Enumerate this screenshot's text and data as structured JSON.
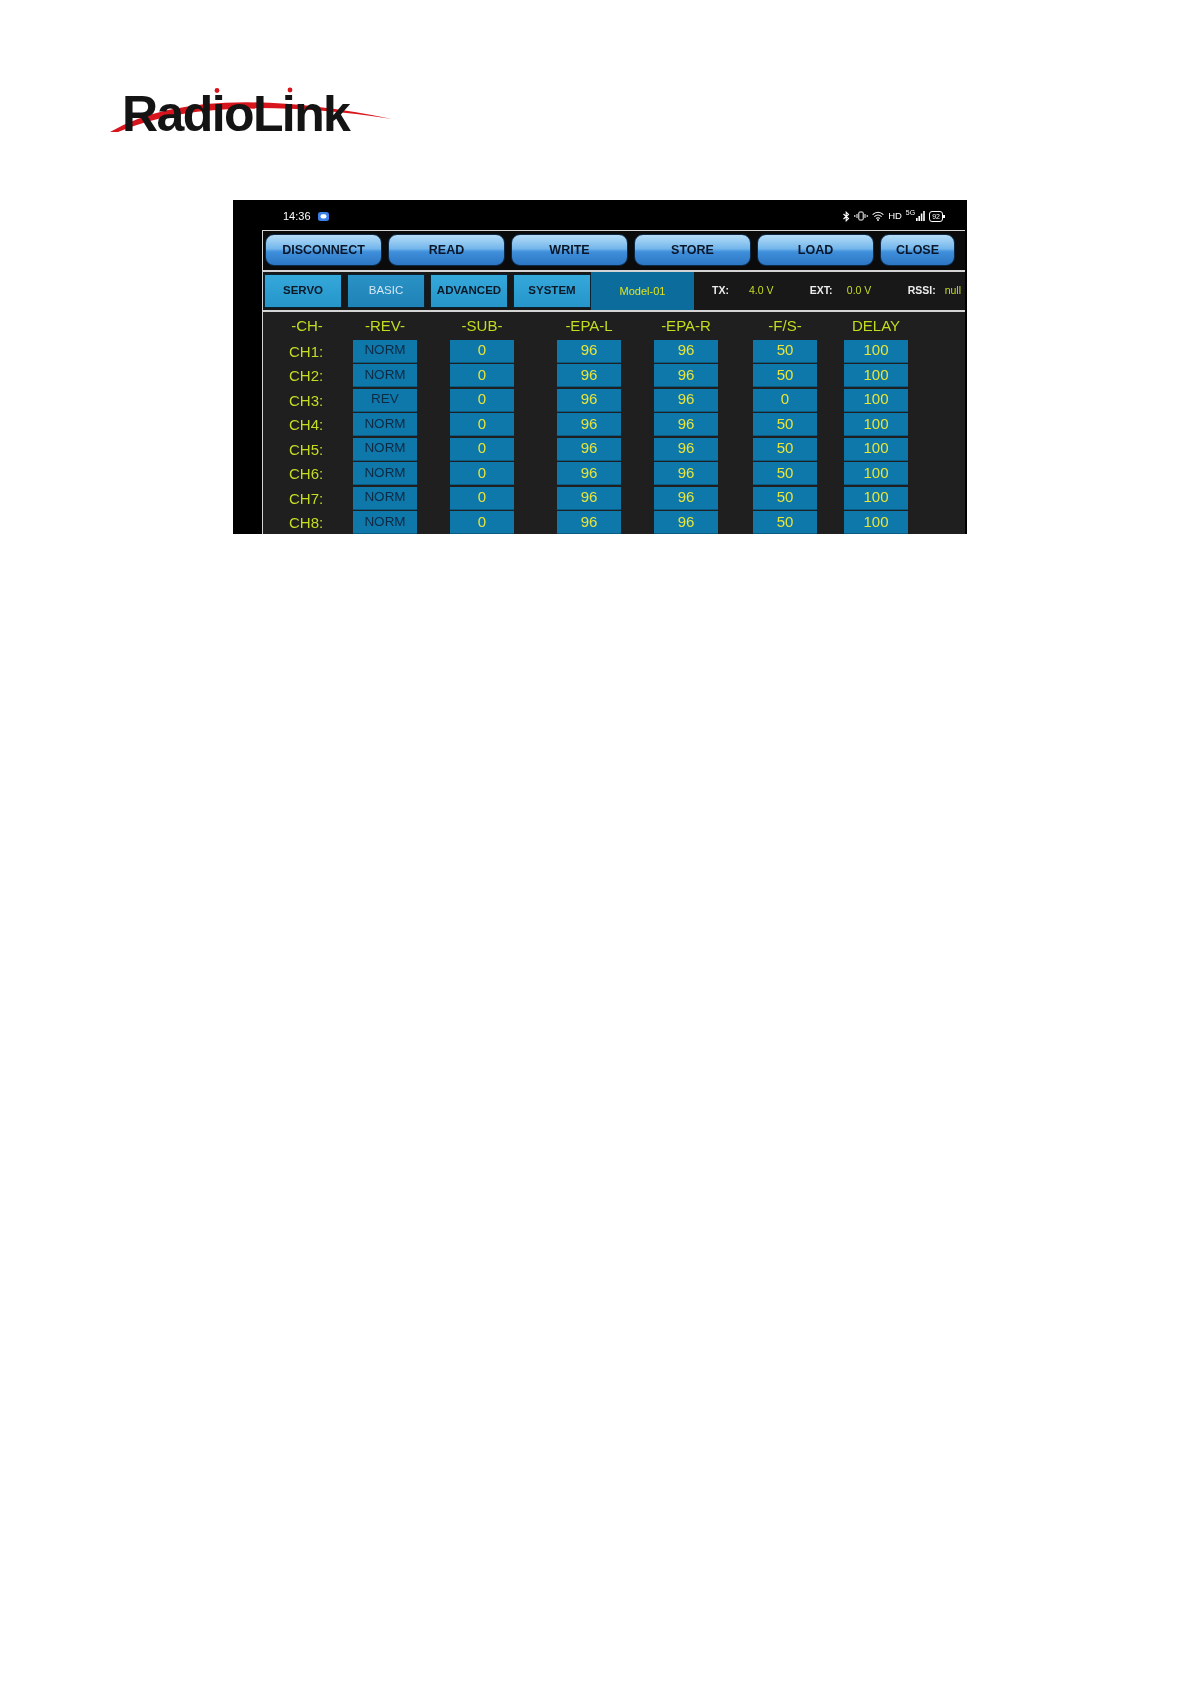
{
  "logo": {
    "text": "RadioLink"
  },
  "status_bar": {
    "time": "14:36",
    "hd": "HD",
    "network": "5G",
    "battery": "92"
  },
  "toolbar": {
    "buttons": [
      "DISCONNECT",
      "READ",
      "WRITE",
      "STORE",
      "LOAD",
      "CLOSE"
    ]
  },
  "tabs": [
    {
      "label": "SERVO",
      "disabled": false
    },
    {
      "label": "BASIC",
      "disabled": true
    },
    {
      "label": "ADVANCED",
      "disabled": false
    },
    {
      "label": "SYSTEM",
      "disabled": false
    }
  ],
  "model": "Model-01",
  "readings": [
    {
      "label": "TX:",
      "value": "4.0 V"
    },
    {
      "label": "EXT:",
      "value": "0.0 V"
    },
    {
      "label": "RSSI:",
      "value": "null"
    }
  ],
  "table": {
    "columns": [
      "-CH-",
      "-REV-",
      "-SUB-",
      "-EPA-L",
      "-EPA-R",
      "-F/S-",
      "DELAY"
    ],
    "rows": [
      [
        "CH1:",
        "NORM",
        "0",
        "96",
        "96",
        "50",
        "100"
      ],
      [
        "CH2:",
        "NORM",
        "0",
        "96",
        "96",
        "50",
        "100"
      ],
      [
        "CH3:",
        "REV",
        "0",
        "96",
        "96",
        "0",
        "100"
      ],
      [
        "CH4:",
        "NORM",
        "0",
        "96",
        "96",
        "50",
        "100"
      ],
      [
        "CH5:",
        "NORM",
        "0",
        "96",
        "96",
        "50",
        "100"
      ],
      [
        "CH6:",
        "NORM",
        "0",
        "96",
        "96",
        "50",
        "100"
      ],
      [
        "CH7:",
        "NORM",
        "0",
        "96",
        "96",
        "50",
        "100"
      ],
      [
        "CH8:",
        "NORM",
        "0",
        "96",
        "96",
        "50",
        "100"
      ]
    ]
  }
}
